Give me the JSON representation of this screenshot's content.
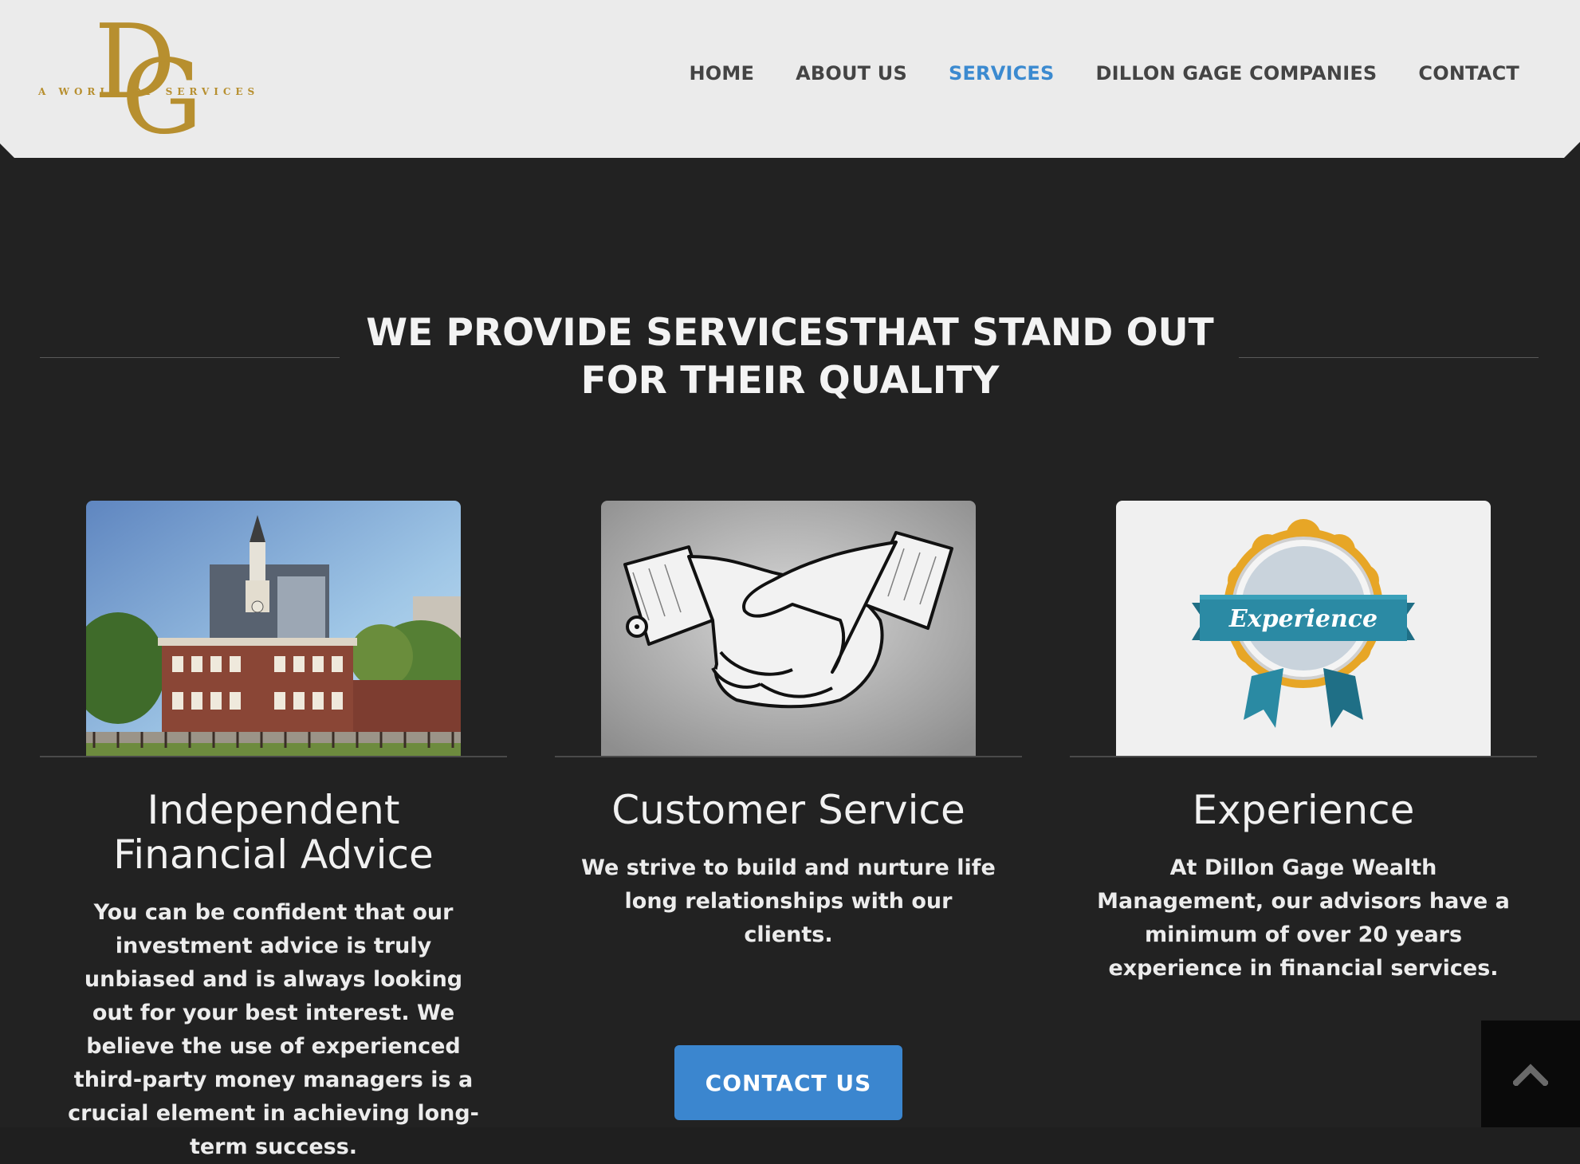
{
  "brand": {
    "tagline": "A WORLD OF SERVICES",
    "monogram": "DG",
    "color": "#b78f2f"
  },
  "nav": {
    "items": [
      {
        "label": "HOME",
        "active": false
      },
      {
        "label": "ABOUT US",
        "active": false
      },
      {
        "label": "SERVICES",
        "active": true
      },
      {
        "label": "DILLON GAGE COMPANIES",
        "active": false
      },
      {
        "label": "CONTACT",
        "active": false
      }
    ],
    "active_color": "#3b8ad0"
  },
  "section": {
    "heading_line1": "WE PROVIDE SERVICESTHAT STAND OUT",
    "heading_line2": "FOR THEIR QUALITY"
  },
  "cards": [
    {
      "image": "independence-hall-photo",
      "title_line1": "Independent",
      "title_line2": "Financial Advice",
      "text": "You can be confident that our investment advice is truly unbiased and is always looking out for your best interest. We believe the use of experienced third-party money managers is a crucial element in achieving long-term success."
    },
    {
      "image": "handshake-illustration",
      "title_line1": "Customer Service",
      "text": "We strive to build and nurture life long relationships with our clients."
    },
    {
      "image": "experience-ribbon-badge",
      "title_line1": "Experience",
      "badge_text": "Experience",
      "text": "At Dillon Gage Wealth Management, our advisors have a minimum of over 20 years experience in financial services."
    }
  ],
  "cta": {
    "label": "CONTACT US",
    "color": "#3b86cf"
  },
  "back_to_top": {
    "icon": "chevron-up-icon"
  }
}
